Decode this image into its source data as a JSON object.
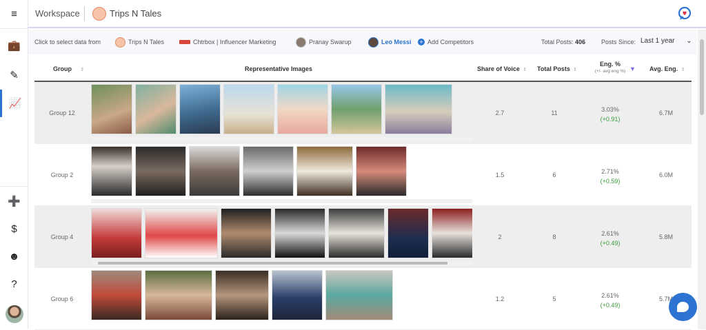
{
  "topbar": {
    "workspace_label": "Workspace",
    "brand_name": "Trips N Tales",
    "app_logo_icon": "speech-heart-logo"
  },
  "left_nav": {
    "items": [
      {
        "icon": "menu-icon",
        "glyph": "≡"
      },
      {
        "icon": "briefcase-icon",
        "glyph": "💼"
      },
      {
        "icon": "pencil-icon",
        "glyph": "✎"
      },
      {
        "icon": "analytics-icon",
        "glyph": "📈"
      },
      {
        "icon": "add-icon",
        "glyph": "➕"
      },
      {
        "icon": "dollar-icon",
        "glyph": "$"
      },
      {
        "icon": "smile-icon",
        "glyph": "☻"
      },
      {
        "icon": "help-icon",
        "glyph": "?"
      }
    ]
  },
  "filter": {
    "prompt": "Click to select data from",
    "sources": [
      "Trips N Tales",
      "Chtrbox | Influencer Marketing",
      "Pranay Swarup",
      "Leo Messi"
    ],
    "add_competitors": "Add Competitors",
    "total_posts_label": "Total Posts:",
    "total_posts_value": "406",
    "since_label": "Posts Since:",
    "since_value": "Last 1 year"
  },
  "table": {
    "headers": {
      "group": "Group",
      "images": "Representative Images",
      "share": "Share of Voice",
      "total": "Total Posts",
      "eng": "Eng. %",
      "eng_sub": "(+/- avg eng %)",
      "avg": "Avg. Eng."
    },
    "rows": [
      {
        "group": "Group 12",
        "share": "2.7",
        "total": "11",
        "eng": "3.03%",
        "delta": "(+0.91)",
        "avg": "6.7M",
        "thumb_width_pct": 0
      },
      {
        "group": "Group 2",
        "share": "1.5",
        "total": "6",
        "eng": "2.71%",
        "delta": "(+0.59)",
        "avg": "6.0M",
        "thumb_width_pct": 0
      },
      {
        "group": "Group 4",
        "share": "2",
        "total": "8",
        "eng": "2.61%",
        "delta": "(+0.49)",
        "avg": "5.8M",
        "thumb_width_pct": 92
      },
      {
        "group": "Group 6",
        "share": "1.2",
        "total": "5",
        "eng": "2.61%",
        "delta": "(+0.49)",
        "avg": "5.7M",
        "thumb_width_pct": 0
      }
    ]
  },
  "colors": {
    "accent": "#2d73d1",
    "positive": "#3a9a3a",
    "sort_active": "#7b6fe0"
  }
}
